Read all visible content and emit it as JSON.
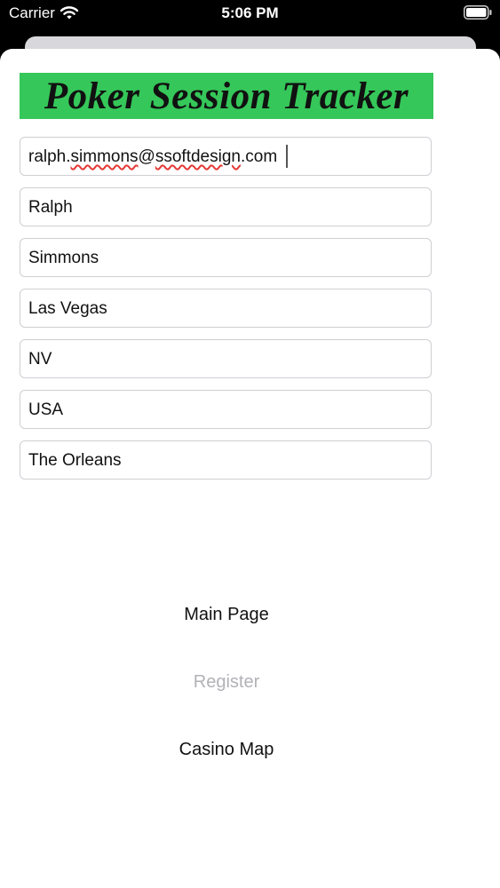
{
  "status_bar": {
    "carrier": "Carrier",
    "time": "5:06 PM"
  },
  "header": {
    "title": "Poker Session Tracker",
    "banner_color": "#35c759"
  },
  "form": {
    "email_user": "ralph",
    "email_dot": ".",
    "email_name": "simmons",
    "email_at": "@",
    "email_domain": "ssoftdesign",
    "email_tld": ".com",
    "first_name": "Ralph",
    "last_name": "Simmons",
    "city": "Las Vegas",
    "state": "NV",
    "country": "USA",
    "casino": "The Orleans"
  },
  "nav": {
    "main_page": "Main Page",
    "register": "Register",
    "casino_map": "Casino Map"
  }
}
